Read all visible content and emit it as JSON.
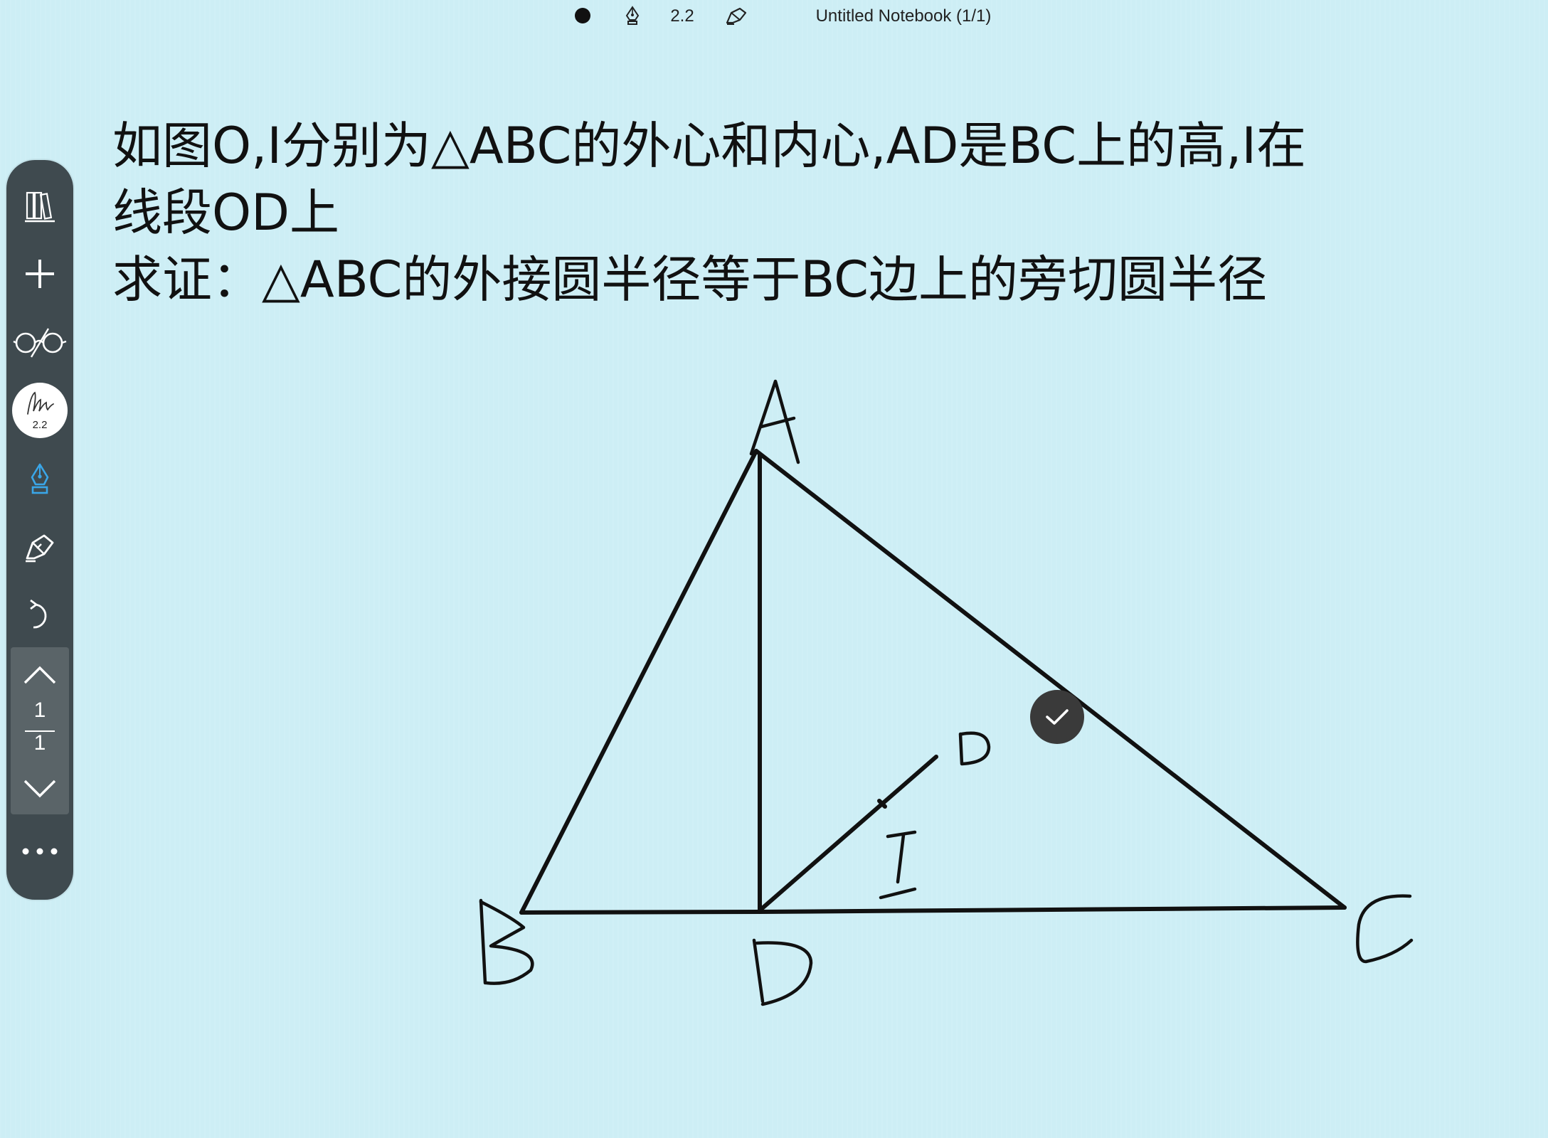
{
  "topbar": {
    "pen_size": "2.2",
    "notebook_title": "Untitled Notebook (1/1)"
  },
  "toolbar": {
    "pen_size": "2.2",
    "page_current": "1",
    "page_total": "1"
  },
  "problem": {
    "line1": "如图O,I分别为△ABC的外心和内心,AD是BC上的高,I在",
    "line2": "线段OD上",
    "line3": "求证：△ABC的外接圆半径等于BC边上的旁切圆半径"
  },
  "colors": {
    "background": "#cdeef5",
    "toolbar": "#3f4a4f",
    "pen_active": "#3aa6e8",
    "ink": "#111111"
  }
}
